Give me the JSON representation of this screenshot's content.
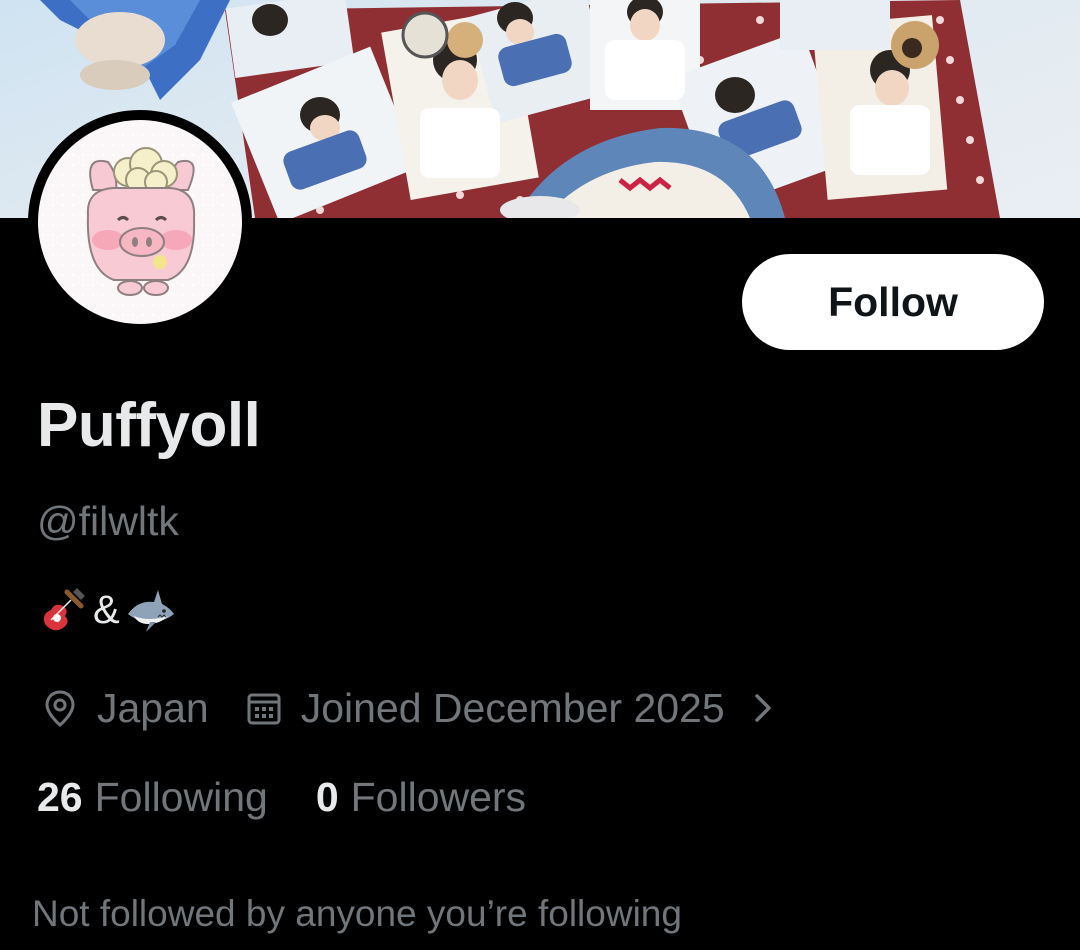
{
  "banner": {
    "description_icon": "photo-card-collage"
  },
  "avatar": {
    "icon": "pink-pig-character"
  },
  "follow_button": {
    "label": "Follow"
  },
  "profile": {
    "display_name": "Puffyoll",
    "handle": "@filwltk",
    "bio_separator": "&",
    "bio_icons": [
      "guitar-icon",
      "shark-icon"
    ],
    "location": "Japan",
    "joined": "Joined December 2025"
  },
  "stats": {
    "following_count": "26",
    "following_label": "Following",
    "followers_count": "0",
    "followers_label": "Followers"
  },
  "mutual_text": "Not followed by anyone you’re following",
  "colors": {
    "background": "#000000",
    "primary_text": "#e7e9ea",
    "secondary_text": "#71767b",
    "button_bg": "#ffffff"
  }
}
